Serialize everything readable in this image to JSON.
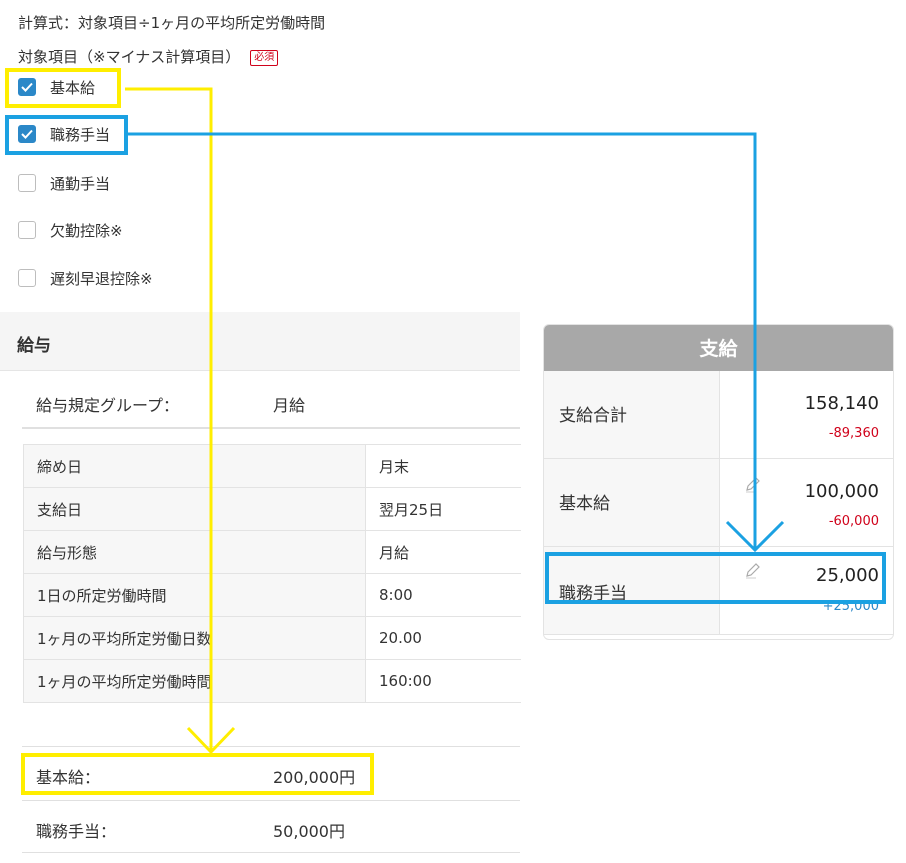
{
  "formula": "計算式：対象項目÷1ヶ月の平均所定労働時間",
  "target_items": {
    "label": "対象項目（※マイナス計算項目）",
    "required_badge": "必須",
    "options": [
      {
        "label": "基本給",
        "checked": true
      },
      {
        "label": "職務手当",
        "checked": true
      },
      {
        "label": "通勤手当",
        "checked": false
      },
      {
        "label": "欠勤控除※",
        "checked": false
      },
      {
        "label": "遅刻早退控除※",
        "checked": false
      }
    ]
  },
  "salary": {
    "title": "給与",
    "group_label": "給与規定グループ：",
    "group_value": "月給",
    "table": [
      {
        "key": "締め日",
        "value": "月末"
      },
      {
        "key": "支給日",
        "value": "翌月25日"
      },
      {
        "key": "給与形態",
        "value": "月給"
      },
      {
        "key": "1日の所定労働時間",
        "value": "8:00"
      },
      {
        "key": "1ヶ月の平均所定労働日数",
        "value": "20.00"
      },
      {
        "key": "1ヶ月の平均所定労働時間",
        "value": "160:00"
      }
    ],
    "amounts": [
      {
        "label": "基本給：",
        "value": "200,000円"
      },
      {
        "label": "職務手当：",
        "value": "50,000円"
      }
    ]
  },
  "payment": {
    "title": "支給",
    "rows": [
      {
        "label": "支給合計",
        "value": "158,140",
        "diff": "-89,360",
        "diff_color": "#d0021b"
      },
      {
        "label": "基本給",
        "value": "100,000",
        "diff": "-60,000",
        "diff_color": "#d0021b"
      },
      {
        "label": "職務手当",
        "value": "25,000",
        "diff": "+25,000",
        "diff_color": "#2b88c8"
      }
    ]
  },
  "colors": {
    "highlight_yellow": "#ffee00",
    "highlight_blue": "#1ba1e2",
    "checkbox_blue": "#2b88c8",
    "negative_red": "#d0021b"
  }
}
